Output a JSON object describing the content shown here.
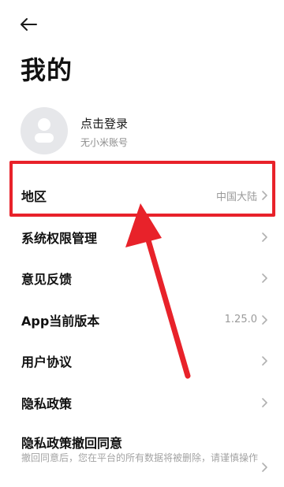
{
  "page": {
    "title": "我的"
  },
  "profile": {
    "name": "点击登录",
    "subtitle": "无小米账号"
  },
  "menu": [
    {
      "label": "地区",
      "value": "中国大陆"
    },
    {
      "label": "系统权限管理",
      "value": ""
    },
    {
      "label": "意见反馈",
      "value": ""
    },
    {
      "label": "App当前版本",
      "value": "1.25.0"
    },
    {
      "label": "用户协议",
      "value": ""
    },
    {
      "label": "隐私政策",
      "value": ""
    }
  ],
  "withdraw": {
    "label": "隐私政策撤回同意",
    "description": "撤回同意后，您在平台的所有数据将被删除，请谨慎操作"
  },
  "icons": {
    "back": "arrow-left-icon",
    "avatar": "user-avatar-icon",
    "chevron": "chevron-right-icon"
  },
  "colors": {
    "highlight": "#e8222a",
    "avatar_bg": "#e6e7ea",
    "secondary_text": "#9a9a9a"
  }
}
